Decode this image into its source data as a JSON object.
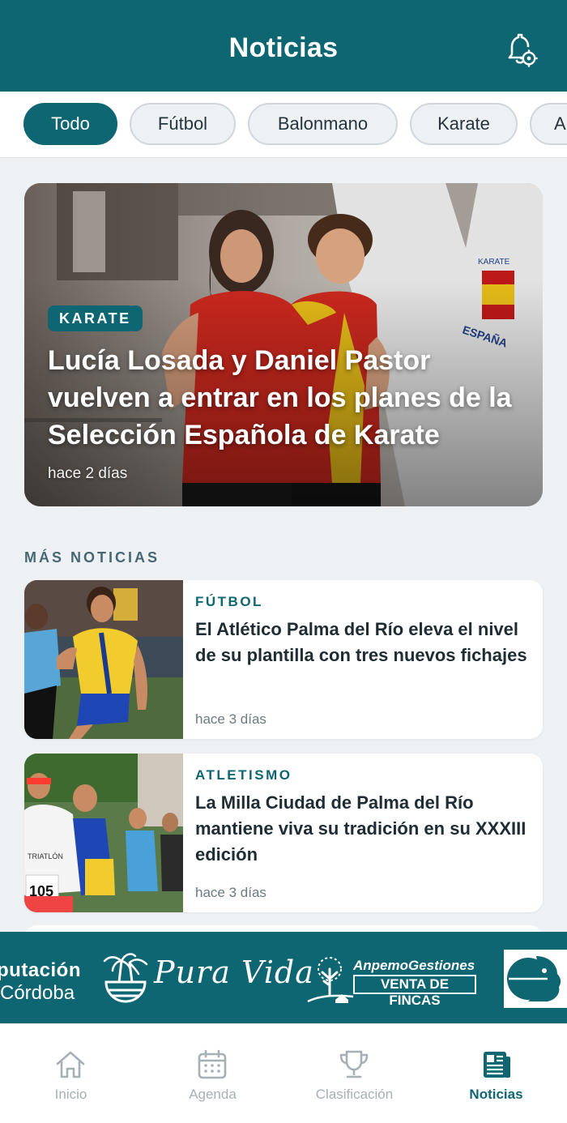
{
  "header": {
    "title": "Noticias",
    "bell_icon": "bell-settings-icon"
  },
  "filters": {
    "chips": [
      {
        "label": "Todo",
        "active": true
      },
      {
        "label": "Fútbol",
        "active": false
      },
      {
        "label": "Balonmano",
        "active": false
      },
      {
        "label": "Karate",
        "active": false
      },
      {
        "label": "A",
        "active": false
      }
    ]
  },
  "featured": {
    "category": "KARATE",
    "title": "Lucía Losada y Daniel Pastor vuelven a entrar en los planes de la Selección Española de Karate",
    "time": "hace 2 días",
    "photo_text": "KARATE\nESPAÑA"
  },
  "section": {
    "label": "MÁS NOTICIAS"
  },
  "news": [
    {
      "category": "FÚTBOL",
      "title": "El Atlético Palma del Río eleva el nivel de su plantilla con tres nuevos fichajes",
      "time": "hace 3 días"
    },
    {
      "category": "ATLETISMO",
      "title": "La Milla Ciudad de Palma del Río mantiene viva su tradición en su XXXIII edición",
      "time": "hace 3 días",
      "bib_number": "105"
    }
  ],
  "sponsors": {
    "diputacion_line1": "putación",
    "diputacion_line2": "Córdoba",
    "puravida": "Pura Vida",
    "anpemo_line1": "AnpemoGestiones",
    "anpemo_line2": "VENTA DE FINCAS"
  },
  "bottom_nav": {
    "items": [
      {
        "label": "Inicio",
        "icon": "home-icon",
        "active": false
      },
      {
        "label": "Agenda",
        "icon": "calendar-icon",
        "active": false
      },
      {
        "label": "Clasificación",
        "icon": "trophy-icon",
        "active": false
      },
      {
        "label": "Noticias",
        "icon": "newspaper-icon",
        "active": true
      }
    ]
  },
  "colors": {
    "primary": "#0e6673",
    "background": "#eef1f4",
    "inactive": "#a6b0b5"
  }
}
